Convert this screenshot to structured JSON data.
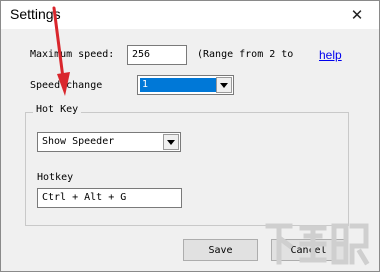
{
  "window": {
    "title": "Settings",
    "close_glyph": "✕"
  },
  "max_speed": {
    "label": "Maximum speed:",
    "value": "256",
    "range_note": "(Range from 2 to",
    "help_label": "help"
  },
  "speed_change": {
    "label": "Speed change",
    "value": "1"
  },
  "hotkey_group": {
    "legend": "Hot Key",
    "action_value": "Show Speeder",
    "hotkey_label": "Hotkey",
    "hotkey_value": "Ctrl + Alt + G"
  },
  "buttons": {
    "save": "Save",
    "cancel": "Cancel"
  },
  "overlay": {
    "arrow_color": "#d9262c",
    "watermark_text": "下载吧",
    "watermark_color": "#c8c8c8"
  },
  "colors": {
    "selection": "#0078d7",
    "link": "#0000ee"
  },
  "icons": {
    "dropdown": "chevron-down-icon",
    "close": "close-icon"
  }
}
